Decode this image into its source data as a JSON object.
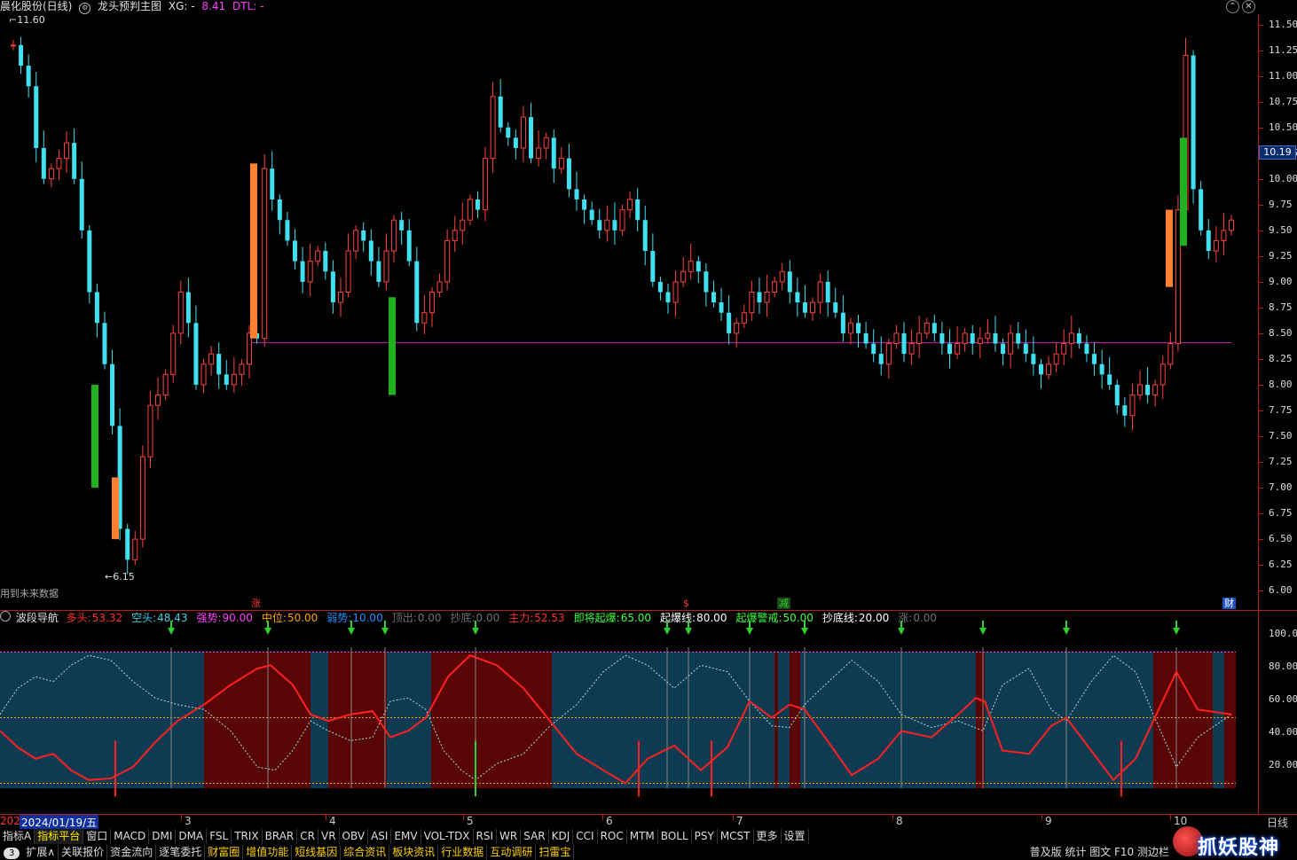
{
  "title": {
    "stock": "晨化股份(日线)",
    "indicator": "龙头预判主图",
    "xg_label": "XG: -",
    "value1": "8.41",
    "dtl_label": "DTL: -"
  },
  "price_axis": {
    "ticks": [
      "11.50",
      "11.25",
      "11.00",
      "10.75",
      "10.50",
      "10.25",
      "10.00",
      "9.75",
      "9.50",
      "9.25",
      "9.00",
      "8.75",
      "8.50",
      "8.25",
      "8.00",
      "7.75",
      "7.50",
      "7.25",
      "7.00",
      "6.75",
      "6.50",
      "6.25",
      "6.00"
    ],
    "current_price": "10.19",
    "range": [
      6.0,
      11.6
    ]
  },
  "annotations": {
    "high_label": "11.60",
    "low_label": "6.15",
    "future_data_note": "用到未来数据",
    "markers": [
      {
        "text": "涨",
        "color": "#ff3030"
      },
      {
        "text": "$",
        "color": "#ff3030"
      },
      {
        "text": "减",
        "color": "#30d030"
      },
      {
        "text": "财",
        "color": "#3080ff"
      }
    ]
  },
  "indicator_header": {
    "name": "波段导航",
    "items": [
      {
        "label": "多头:",
        "value": "53.32",
        "color": "#ff3030"
      },
      {
        "label": "空头:",
        "value": "48.43",
        "color": "#40d0e0"
      },
      {
        "label": "强势:",
        "value": "90.00",
        "color": "#ff40ff"
      },
      {
        "label": "中位:",
        "value": "50.00",
        "color": "#ffa000"
      },
      {
        "label": "弱势:",
        "value": "10.00",
        "color": "#2090ff"
      },
      {
        "label": "顶出:",
        "value": "0.00",
        "color": "#707070"
      },
      {
        "label": "抄底:",
        "value": "0.00",
        "color": "#707070"
      },
      {
        "label": "主力:",
        "value": "52.53",
        "color": "#ff3030"
      },
      {
        "label": "即将起爆:",
        "value": "65.00",
        "color": "#40ff40"
      },
      {
        "label": "起爆线:",
        "value": "80.00",
        "color": "#ffffff"
      },
      {
        "label": "起爆警戒:",
        "value": "50.00",
        "color": "#40ff40"
      },
      {
        "label": "抄底线:",
        "value": "20.00",
        "color": "#ffffff"
      },
      {
        "label": "涨:",
        "value": "0.00",
        "color": "#707070"
      }
    ]
  },
  "indicator_axis": {
    "ticks": [
      "100.00",
      "80.00",
      "60.00",
      "40.00",
      "20.00"
    ]
  },
  "date_axis": {
    "start_label": "202",
    "selected_date": "2024/01/19/五",
    "month_labels": [
      "3",
      "4",
      "5",
      "6",
      "7",
      "8",
      "9",
      "10"
    ],
    "period": "日线"
  },
  "tabs_row1": [
    "指标A",
    "指标平台",
    "窗口",
    "MACD",
    "DMI",
    "DMA",
    "FSL",
    "TRIX",
    "BRAR",
    "CR",
    "VR",
    "OBV",
    "ASI",
    "EMV",
    "VOL-TDX",
    "RSI",
    "WR",
    "SAR",
    "KDJ",
    "CCI",
    "ROC",
    "MTM",
    "BOLL",
    "PSY",
    "MCST",
    "更多",
    "设置"
  ],
  "tabs_row2": [
    "扩展∧",
    "关联报价",
    "资金流向",
    "逐笔委托",
    "财富圈",
    "增值功能",
    "短线基因",
    "综合资讯",
    "板块资讯",
    "行业数据",
    "互动调研",
    "扫雷宝"
  ],
  "row2_right": "普及版 统计 图文 F10 测边栏",
  "toggle_label": "3",
  "watermark": "抓妖股神"
}
